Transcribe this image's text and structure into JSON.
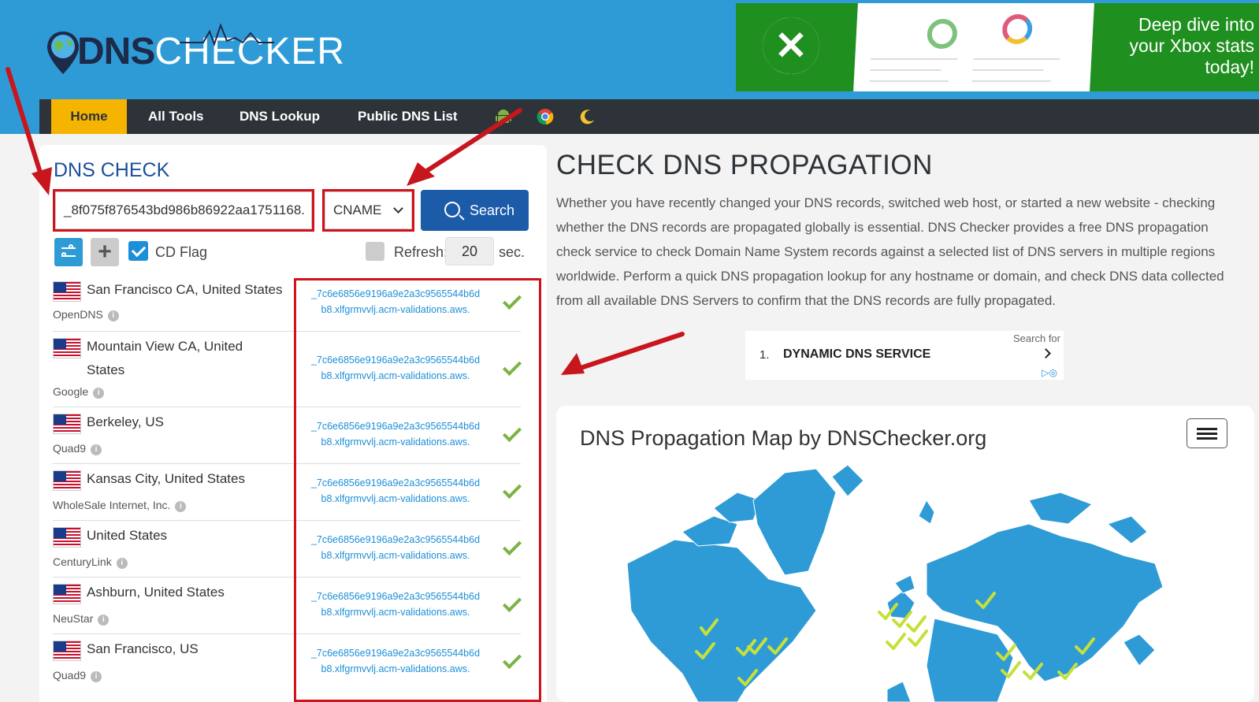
{
  "header": {
    "logo": {
      "part1": "DNS",
      "part2": "CHECKER"
    },
    "ad": {
      "text": "Deep dive into your Xbox stats today!"
    }
  },
  "nav": {
    "items": [
      "Home",
      "All Tools",
      "DNS Lookup",
      "Public DNS List"
    ],
    "icons": [
      "android-icon",
      "chrome-icon",
      "moon-icon"
    ]
  },
  "dns_check": {
    "title": "DNS CHECK",
    "domain_value": "_8f075f876543bd986b86922aa1751168.",
    "record_type": "CNAME",
    "search_label": "Search",
    "cd_flag_label": "CD Flag",
    "refresh_label": "Refresh:",
    "refresh_value": "20",
    "refresh_unit": "sec.",
    "results": [
      {
        "location": "San Francisco CA, United States",
        "isp": "OpenDNS",
        "value_line1": "_7c6e6856e9196a9e2a3c9565544b6d",
        "value_line2": "b8.xlfgrmvvlj.acm-validations.aws."
      },
      {
        "location": "Mountain View CA, United States",
        "isp": "Google",
        "value_line1": "_7c6e6856e9196a9e2a3c9565544b6d",
        "value_line2": "b8.xlfgrmvvlj.acm-validations.aws."
      },
      {
        "location": "Berkeley, US",
        "isp": "Quad9",
        "value_line1": "_7c6e6856e9196a9e2a3c9565544b6d",
        "value_line2": "b8.xlfgrmvvlj.acm-validations.aws."
      },
      {
        "location": "Kansas City, United States",
        "isp": "WholeSale Internet, Inc.",
        "value_line1": "_7c6e6856e9196a9e2a3c9565544b6d",
        "value_line2": "b8.xlfgrmvvlj.acm-validations.aws."
      },
      {
        "location": "United States",
        "isp": "CenturyLink",
        "value_line1": "_7c6e6856e9196a9e2a3c9565544b6d",
        "value_line2": "b8.xlfgrmvvlj.acm-validations.aws."
      },
      {
        "location": "Ashburn, United States",
        "isp": "NeuStar",
        "value_line1": "_7c6e6856e9196a9e2a3c9565544b6d",
        "value_line2": "b8.xlfgrmvvlj.acm-validations.aws."
      },
      {
        "location": "San Francisco, US",
        "isp": "Quad9",
        "value_line1": "_7c6e6856e9196a9e2a3c9565544b6d",
        "value_line2": "b8.xlfgrmvvlj.acm-validations.aws."
      }
    ]
  },
  "propagation": {
    "title": "CHECK DNS PROPAGATION",
    "description": "Whether you have recently changed your DNS records, switched web host, or started a new website - checking whether the DNS records are propagated globally is essential. DNS Checker provides a free DNS propagation check service to check Domain Name System records against a selected list of DNS servers in multiple regions worldwide. Perform a quick DNS propagation lookup for any hostname or domain, and check DNS data collected from all available DNS Servers to confirm that the DNS records are fully propagated."
  },
  "ad_search": {
    "label": "Search for",
    "number": "1.",
    "text": "DYNAMIC DNS SERVICE"
  },
  "map": {
    "title": "DNS Propagation Map by DNSChecker.org"
  },
  "colors": {
    "header_bg": "#2e9bd6",
    "nav_bg": "#2d3338",
    "home_tab": "#f4b400",
    "primary_blue": "#1c5ba8",
    "highlight_red": "#d0121b",
    "check_green": "#7cb342"
  }
}
